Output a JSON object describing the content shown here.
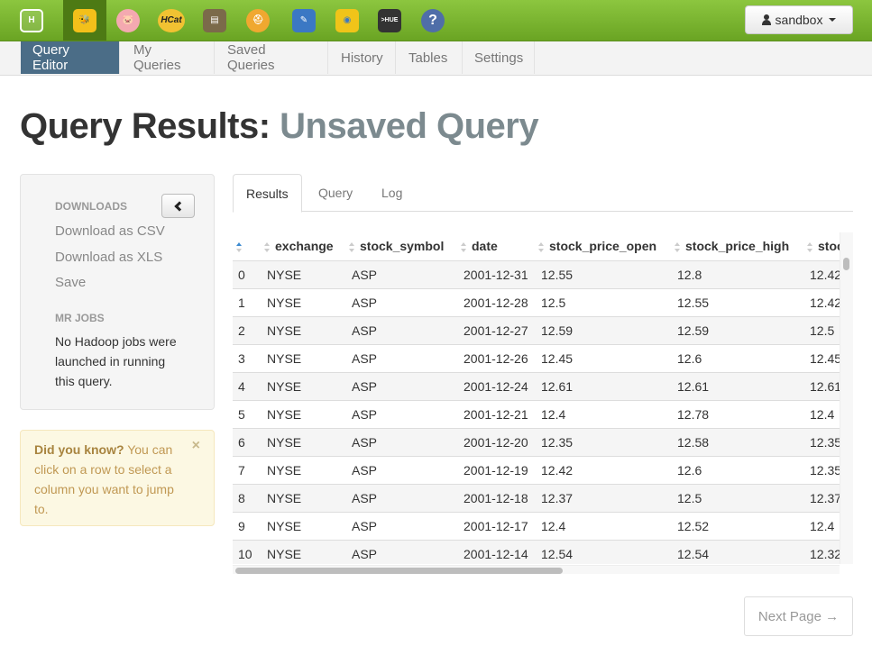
{
  "topbar": {
    "apps": [
      {
        "name": "hue-logo-icon",
        "glyph": "H",
        "color": "#5b8f1c"
      },
      {
        "name": "beeswax-icon",
        "glyph": "🐝",
        "color": "#f3c01a",
        "active": true
      },
      {
        "name": "pig-icon",
        "glyph": "🐷",
        "color": "#f4a9b0"
      },
      {
        "name": "hcat-icon",
        "glyph": "HCat",
        "color": "#f1c232"
      },
      {
        "name": "file-browser-icon",
        "glyph": "▤",
        "color": "#7b6a4a"
      },
      {
        "name": "job-designer-icon",
        "glyph": "⛑",
        "color": "#f0a830"
      },
      {
        "name": "oozie-icon",
        "glyph": "✎",
        "color": "#3b78c4"
      },
      {
        "name": "job-browser-icon",
        "glyph": "◉",
        "color": "#f0c419"
      },
      {
        "name": "shell-icon",
        "glyph": ">HUE",
        "color": "#333333"
      },
      {
        "name": "help-icon",
        "glyph": "?",
        "color": "#4f6ea8"
      }
    ],
    "user_label": "sandbox"
  },
  "subnav": {
    "items": [
      "Query Editor",
      "My Queries",
      "Saved Queries",
      "History",
      "Tables",
      "Settings"
    ]
  },
  "title": {
    "main": "Query Results:",
    "query_name": "Unsaved Query"
  },
  "sidebar": {
    "downloads_heading": "DOWNLOADS",
    "links": [
      "Download as CSV",
      "Download as XLS",
      "Save"
    ],
    "mr_jobs_heading": "MR JOBS",
    "mr_jobs_text": "No Hadoop jobs were launched in running this query."
  },
  "tip": {
    "lead": "Did you know?",
    "body": " You can click on a row to select a column you want to jump to.",
    "close": "×"
  },
  "tabs": [
    "Results",
    "Query",
    "Log"
  ],
  "table": {
    "headers": [
      "",
      "exchange",
      "stock_symbol",
      "date",
      "stock_price_open",
      "stock_price_high",
      "stock_"
    ],
    "rows": [
      [
        "0",
        "NYSE",
        "ASP",
        "2001-12-31",
        "12.55",
        "12.8",
        "12.42"
      ],
      [
        "1",
        "NYSE",
        "ASP",
        "2001-12-28",
        "12.5",
        "12.55",
        "12.42"
      ],
      [
        "2",
        "NYSE",
        "ASP",
        "2001-12-27",
        "12.59",
        "12.59",
        "12.5"
      ],
      [
        "3",
        "NYSE",
        "ASP",
        "2001-12-26",
        "12.45",
        "12.6",
        "12.45"
      ],
      [
        "4",
        "NYSE",
        "ASP",
        "2001-12-24",
        "12.61",
        "12.61",
        "12.61"
      ],
      [
        "5",
        "NYSE",
        "ASP",
        "2001-12-21",
        "12.4",
        "12.78",
        "12.4"
      ],
      [
        "6",
        "NYSE",
        "ASP",
        "2001-12-20",
        "12.35",
        "12.58",
        "12.35"
      ],
      [
        "7",
        "NYSE",
        "ASP",
        "2001-12-19",
        "12.42",
        "12.6",
        "12.35"
      ],
      [
        "8",
        "NYSE",
        "ASP",
        "2001-12-18",
        "12.37",
        "12.5",
        "12.37"
      ],
      [
        "9",
        "NYSE",
        "ASP",
        "2001-12-17",
        "12.4",
        "12.52",
        "12.4"
      ],
      [
        "10",
        "NYSE",
        "ASP",
        "2001-12-14",
        "12.54",
        "12.54",
        "12.32"
      ]
    ]
  },
  "pagination": {
    "next_label": "Next Page →"
  },
  "colors": {
    "topbar_green": "#7ab734",
    "active_subnav": "#4b6d87",
    "title_muted": "#7c8a8f"
  }
}
